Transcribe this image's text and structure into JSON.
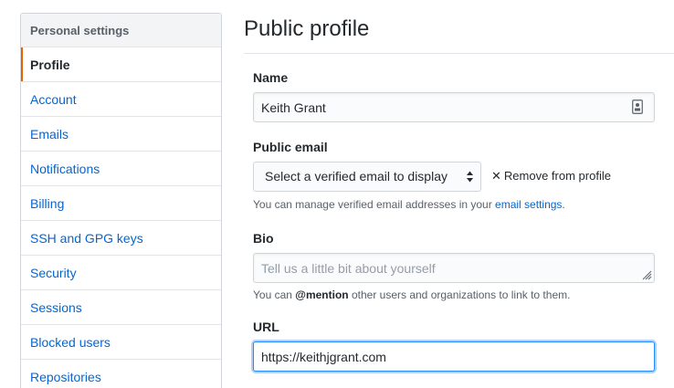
{
  "sidebar": {
    "header": "Personal settings",
    "items": [
      {
        "label": "Profile",
        "selected": true
      },
      {
        "label": "Account"
      },
      {
        "label": "Emails"
      },
      {
        "label": "Notifications"
      },
      {
        "label": "Billing"
      },
      {
        "label": "SSH and GPG keys"
      },
      {
        "label": "Security"
      },
      {
        "label": "Sessions"
      },
      {
        "label": "Blocked users"
      },
      {
        "label": "Repositories"
      }
    ]
  },
  "main": {
    "title": "Public profile",
    "name": {
      "label": "Name",
      "value": "Keith Grant",
      "icon": "contact-card-icon"
    },
    "public_email": {
      "label": "Public email",
      "selected": "Select a verified email to display",
      "remove_label": "Remove from profile",
      "note_prefix": "You can manage verified email addresses in your ",
      "note_link": "email settings",
      "note_suffix": "."
    },
    "bio": {
      "label": "Bio",
      "placeholder": "Tell us a little bit about yourself",
      "note_prefix": "You can ",
      "note_mention": "@mention",
      "note_suffix": " other users and organizations to link to them."
    },
    "url": {
      "label": "URL",
      "value": "https://keithjgrant.com"
    }
  },
  "colors": {
    "link": "#0366d6",
    "selected_indicator": "#e36209",
    "focus_border": "#2188ff"
  }
}
